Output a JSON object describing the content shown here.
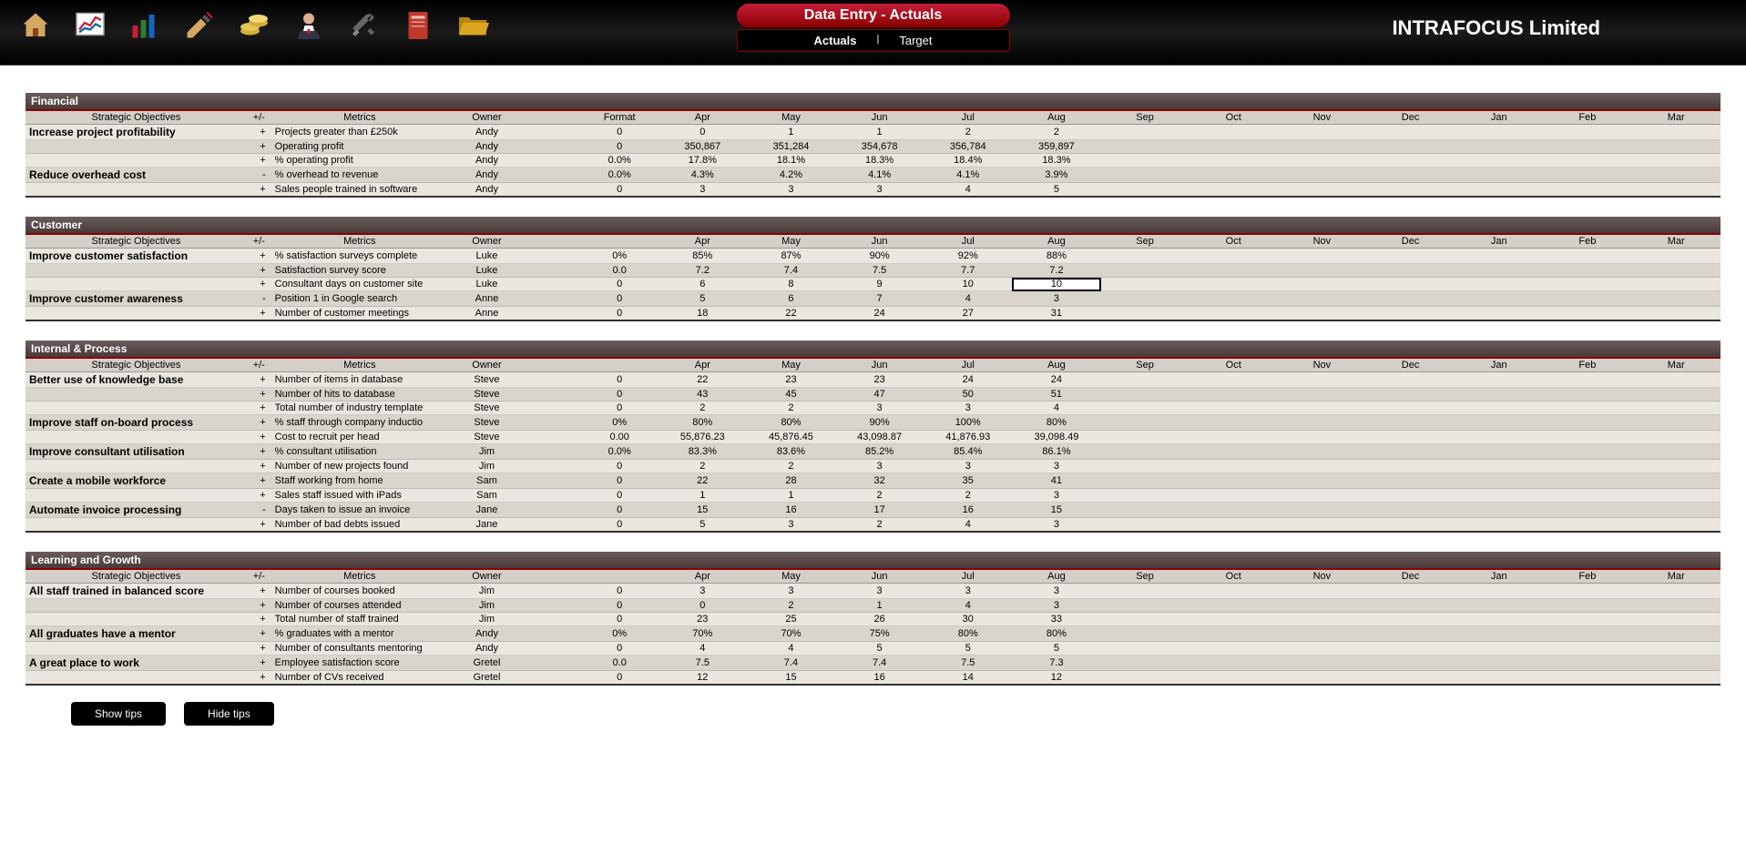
{
  "company": "INTRAFOCUS Limited",
  "title": "Data Entry - Actuals",
  "tabs": {
    "actuals": "Actuals",
    "sep": "|",
    "target": "Target"
  },
  "buttons": {
    "showTips": "Show tips",
    "hideTips": "Hide tips"
  },
  "columns": {
    "objectives": "Strategic Objectives",
    "sign": "+/-",
    "metrics": "Metrics",
    "owner": "Owner",
    "format": "Format",
    "months": [
      "Apr",
      "May",
      "Jun",
      "Jul",
      "Aug",
      "Sep",
      "Oct",
      "Nov",
      "Dec",
      "Jan",
      "Feb",
      "Mar"
    ]
  },
  "sections": [
    {
      "name": "Financial",
      "showFormat": true,
      "rows": [
        {
          "objective": "Increase project profitability",
          "sign": "+",
          "metric": "Projects greater than £250k",
          "owner": "Andy",
          "format": "0",
          "vals": [
            "0",
            "1",
            "1",
            "2",
            "2"
          ]
        },
        {
          "objective": "",
          "sign": "+",
          "metric": "Operating profit",
          "owner": "Andy",
          "format": "0",
          "vals": [
            "350,867",
            "351,284",
            "354,678",
            "356,784",
            "359,897"
          ]
        },
        {
          "objective": "",
          "sign": "+",
          "metric": "% operating profit",
          "owner": "Andy",
          "format": "0.0%",
          "vals": [
            "17.8%",
            "18.1%",
            "18.3%",
            "18.4%",
            "18.3%"
          ]
        },
        {
          "objective": "Reduce overhead cost",
          "sign": "-",
          "metric": "% overhead to revenue",
          "owner": "Andy",
          "format": "0.0%",
          "vals": [
            "4.3%",
            "4.2%",
            "4.1%",
            "4.1%",
            "3.9%"
          ]
        },
        {
          "objective": "",
          "sign": "+",
          "metric": "Sales people trained in software",
          "owner": "Andy",
          "format": "0",
          "vals": [
            "3",
            "3",
            "3",
            "4",
            "5"
          ]
        }
      ]
    },
    {
      "name": "Customer",
      "showFormat": false,
      "rows": [
        {
          "objective": "Improve customer satisfaction",
          "sign": "+",
          "metric": "% satisfaction surveys complete",
          "owner": "Luke",
          "format": "0%",
          "vals": [
            "85%",
            "87%",
            "90%",
            "92%",
            "88%"
          ]
        },
        {
          "objective": "",
          "sign": "+",
          "metric": "Satisfaction survey score",
          "owner": "Luke",
          "format": "0.0",
          "vals": [
            "7.2",
            "7.4",
            "7.5",
            "7.7",
            "7.2"
          ]
        },
        {
          "objective": "",
          "sign": "+",
          "metric": "Consultant days on customer site",
          "owner": "Luke",
          "format": "0",
          "vals": [
            "6",
            "8",
            "9",
            "10",
            "10"
          ],
          "selected": 4
        },
        {
          "objective": "Improve customer awareness",
          "sign": "-",
          "metric": "Position 1 in Google search",
          "owner": "Anne",
          "format": "0",
          "vals": [
            "5",
            "6",
            "7",
            "4",
            "3"
          ]
        },
        {
          "objective": "",
          "sign": "+",
          "metric": "Number of customer meetings",
          "owner": "Anne",
          "format": "0",
          "vals": [
            "18",
            "22",
            "24",
            "27",
            "31"
          ]
        }
      ]
    },
    {
      "name": "Internal & Process",
      "showFormat": false,
      "rows": [
        {
          "objective": "Better use of knowledge base",
          "sign": "+",
          "metric": "Number of items in database",
          "owner": "Steve",
          "format": "0",
          "vals": [
            "22",
            "23",
            "23",
            "24",
            "24"
          ]
        },
        {
          "objective": "",
          "sign": "+",
          "metric": "Number of hits to database",
          "owner": "Steve",
          "format": "0",
          "vals": [
            "43",
            "45",
            "47",
            "50",
            "51"
          ]
        },
        {
          "objective": "",
          "sign": "+",
          "metric": "Total number of industry template",
          "owner": "Steve",
          "format": "0",
          "vals": [
            "2",
            "2",
            "3",
            "3",
            "4"
          ]
        },
        {
          "objective": "Improve staff on-board process",
          "sign": "+",
          "metric": "% staff through company inductio",
          "owner": "Steve",
          "format": "0%",
          "vals": [
            "80%",
            "80%",
            "90%",
            "100%",
            "80%"
          ]
        },
        {
          "objective": "",
          "sign": "+",
          "metric": "Cost to recruit per head",
          "owner": "Steve",
          "format": "0.00",
          "vals": [
            "55,876.23",
            "45,876.45",
            "43,098.87",
            "41,876.93",
            "39,098.49"
          ]
        },
        {
          "objective": "Improve consultant utilisation",
          "sign": "+",
          "metric": "% consultant utilisation",
          "owner": "Jim",
          "format": "0.0%",
          "vals": [
            "83.3%",
            "83.6%",
            "85.2%",
            "85.4%",
            "86.1%"
          ]
        },
        {
          "objective": "",
          "sign": "+",
          "metric": "Number of new projects found",
          "owner": "Jim",
          "format": "0",
          "vals": [
            "2",
            "2",
            "3",
            "3",
            "3"
          ]
        },
        {
          "objective": "Create a mobile workforce",
          "sign": "+",
          "metric": "Staff working from home",
          "owner": "Sam",
          "format": "0",
          "vals": [
            "22",
            "28",
            "32",
            "35",
            "41"
          ]
        },
        {
          "objective": "",
          "sign": "+",
          "metric": "Sales staff issued with iPads",
          "owner": "Sam",
          "format": "0",
          "vals": [
            "1",
            "1",
            "2",
            "2",
            "3"
          ]
        },
        {
          "objective": "Automate invoice processing",
          "sign": "-",
          "metric": "Days taken to issue an invoice",
          "owner": "Jane",
          "format": "0",
          "vals": [
            "15",
            "16",
            "17",
            "16",
            "15"
          ]
        },
        {
          "objective": "",
          "sign": "+",
          "metric": "Number of bad debts issued",
          "owner": "Jane",
          "format": "0",
          "vals": [
            "5",
            "3",
            "2",
            "4",
            "3"
          ]
        }
      ]
    },
    {
      "name": "Learning and Growth",
      "showFormat": false,
      "rows": [
        {
          "objective": "All staff trained in balanced score",
          "sign": "+",
          "metric": "Number of courses booked",
          "owner": "Jim",
          "format": "0",
          "vals": [
            "3",
            "3",
            "3",
            "3",
            "3"
          ]
        },
        {
          "objective": "",
          "sign": "+",
          "metric": "Number of courses attended",
          "owner": "Jim",
          "format": "0",
          "vals": [
            "0",
            "2",
            "1",
            "4",
            "3"
          ]
        },
        {
          "objective": "",
          "sign": "+",
          "metric": "Total number of staff trained",
          "owner": "Jim",
          "format": "0",
          "vals": [
            "23",
            "25",
            "26",
            "30",
            "33"
          ]
        },
        {
          "objective": "All graduates have a mentor",
          "sign": "+",
          "metric": "% graduates with a mentor",
          "owner": "Andy",
          "format": "0%",
          "vals": [
            "70%",
            "70%",
            "75%",
            "80%",
            "80%"
          ]
        },
        {
          "objective": "",
          "sign": "+",
          "metric": "Number of consultants mentoring",
          "owner": "Andy",
          "format": "0",
          "vals": [
            "4",
            "4",
            "5",
            "5",
            "5"
          ]
        },
        {
          "objective": "A great place to work",
          "sign": "+",
          "metric": "Employee satisfaction score",
          "owner": "Gretel",
          "format": "0.0",
          "vals": [
            "7.5",
            "7.4",
            "7.4",
            "7.5",
            "7.3"
          ]
        },
        {
          "objective": "",
          "sign": "+",
          "metric": "Number of CVs received",
          "owner": "Gretel",
          "format": "0",
          "vals": [
            "12",
            "15",
            "16",
            "14",
            "12"
          ]
        }
      ]
    }
  ]
}
